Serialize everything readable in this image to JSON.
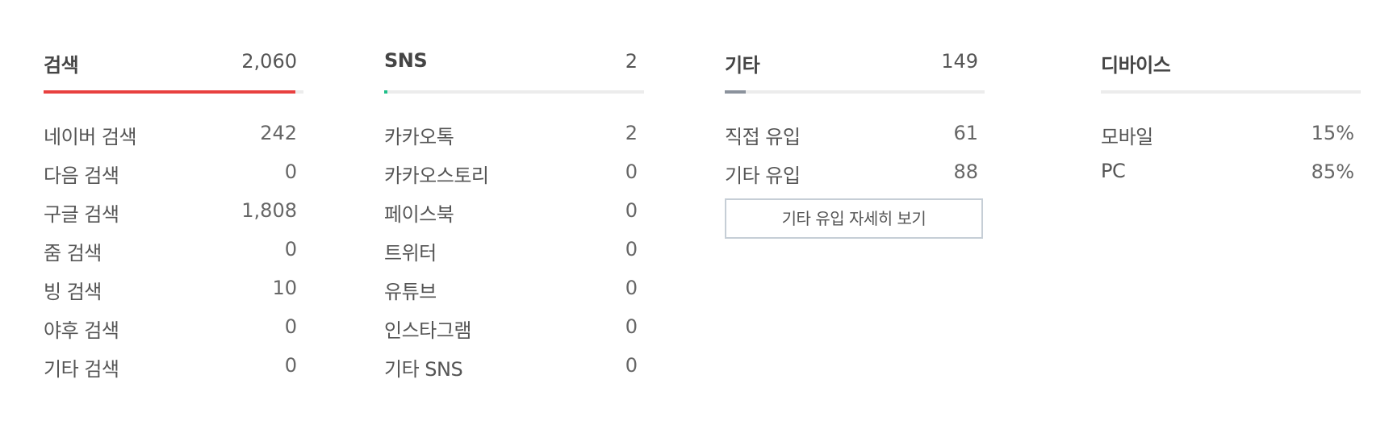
{
  "colors": {
    "search_bar": "#e8403f",
    "sns_bar": "#1fbf89",
    "etc_bar": "#8b929c",
    "track": "#ececec"
  },
  "search": {
    "title": "검색",
    "total": "2,060",
    "bar_fraction": 0.97,
    "items": [
      {
        "label": "네이버 검색",
        "value": "242"
      },
      {
        "label": "다음 검색",
        "value": "0"
      },
      {
        "label": "구글 검색",
        "value": "1,808"
      },
      {
        "label": "줌 검색",
        "value": "0"
      },
      {
        "label": "빙 검색",
        "value": "10"
      },
      {
        "label": "야후 검색",
        "value": "0"
      },
      {
        "label": "기타 검색",
        "value": "0"
      }
    ]
  },
  "sns": {
    "title": "SNS",
    "total": "2",
    "bar_fraction": 0.01,
    "items": [
      {
        "label": "카카오톡",
        "value": "2"
      },
      {
        "label": "카카오스토리",
        "value": "0"
      },
      {
        "label": "페이스북",
        "value": "0"
      },
      {
        "label": "트위터",
        "value": "0"
      },
      {
        "label": "유튜브",
        "value": "0"
      },
      {
        "label": "인스타그램",
        "value": "0"
      },
      {
        "label": "기타 SNS",
        "value": "0"
      }
    ]
  },
  "etc": {
    "title": "기타",
    "total": "149",
    "bar_fraction": 0.08,
    "items": [
      {
        "label": "직접 유입",
        "value": "61"
      },
      {
        "label": "기타 유입",
        "value": "88"
      }
    ],
    "detail_button": "기타 유입 자세히 보기"
  },
  "device": {
    "title": "디바이스",
    "items": [
      {
        "label": "모바일",
        "value": "15%"
      },
      {
        "label": "PC",
        "value": "85%"
      }
    ]
  }
}
